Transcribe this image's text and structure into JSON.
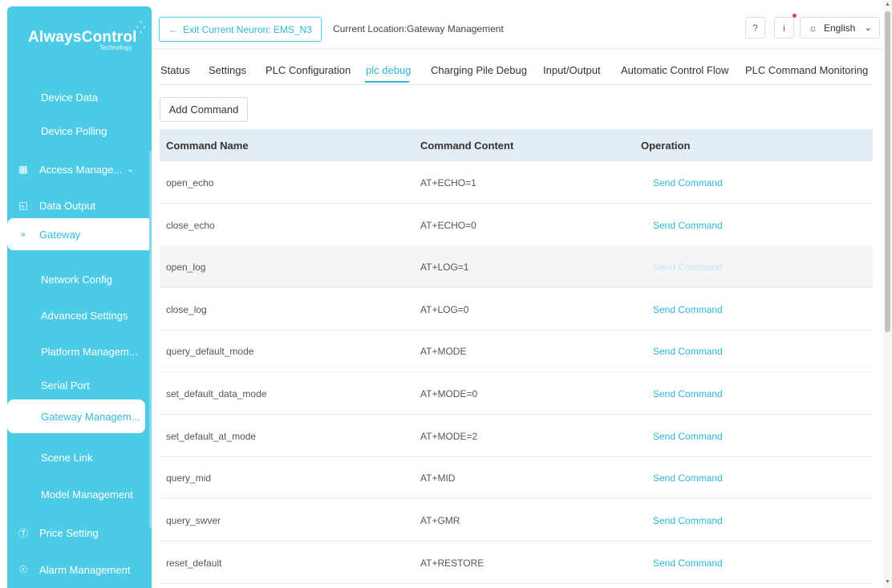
{
  "sidebar": {
    "logo": {
      "main": "AlwaysControl",
      "sub": "Technology"
    },
    "items": [
      {
        "label": "Device Data",
        "icon": ""
      },
      {
        "label": "Device Polling",
        "icon": ""
      },
      {
        "label": "Access Manage...",
        "icon": "building-icon"
      },
      {
        "label": "Data Output",
        "icon": "export-icon"
      },
      {
        "label": "Gateway",
        "icon": "gateway-icon"
      },
      {
        "label": "Network Config",
        "icon": ""
      },
      {
        "label": "Advanced Settings",
        "icon": ""
      },
      {
        "label": "Platform Managem...",
        "icon": ""
      },
      {
        "label": "Serial Port",
        "icon": ""
      },
      {
        "label": "Gateway Managem...",
        "icon": ""
      },
      {
        "label": "Scene Link",
        "icon": ""
      },
      {
        "label": "Model Management",
        "icon": ""
      },
      {
        "label": "Price Setting",
        "icon": "dollar-icon"
      },
      {
        "label": "Alarm Management",
        "icon": "alarm-icon"
      }
    ]
  },
  "header": {
    "exit_button": "Exit Current Neuron: EMS_N3",
    "location": "Current Location:Gateway Management",
    "language": "English"
  },
  "tabs": [
    "Status",
    "Settings",
    "PLC Configuration",
    "plc debug",
    "Charging Pile Debug",
    "Input/Output",
    "Automatic Control Flow",
    "PLC Command Monitoring"
  ],
  "add_command": "Add Command",
  "table": {
    "headers": [
      "Command Name",
      "Command Content",
      "Operation"
    ],
    "rows": [
      {
        "name": "open_echo",
        "content": "AT+ECHO=1",
        "op": "Send Command"
      },
      {
        "name": "close_echo",
        "content": "AT+ECHO=0",
        "op": "Send Command"
      },
      {
        "name": "open_log",
        "content": "AT+LOG=1",
        "op": "Send Command"
      },
      {
        "name": "close_log",
        "content": "AT+LOG=0",
        "op": "Send Command"
      },
      {
        "name": "query_default_mode",
        "content": "AT+MODE",
        "op": "Send Command"
      },
      {
        "name": "set_default_data_mode",
        "content": "AT+MODE=0",
        "op": "Send Command"
      },
      {
        "name": "set_default_at_mode",
        "content": "AT+MODE=2",
        "op": "Send Command"
      },
      {
        "name": "query_mid",
        "content": "AT+MID",
        "op": "Send Command"
      },
      {
        "name": "query_swver",
        "content": "AT+GMR",
        "op": "Send Command"
      },
      {
        "name": "reset_default",
        "content": "AT+RESTORE",
        "op": "Send Command"
      }
    ]
  },
  "colors": {
    "sidebar": "#4ccbe6",
    "accent": "#2fb5d9",
    "table_header": "#e3edf6"
  }
}
